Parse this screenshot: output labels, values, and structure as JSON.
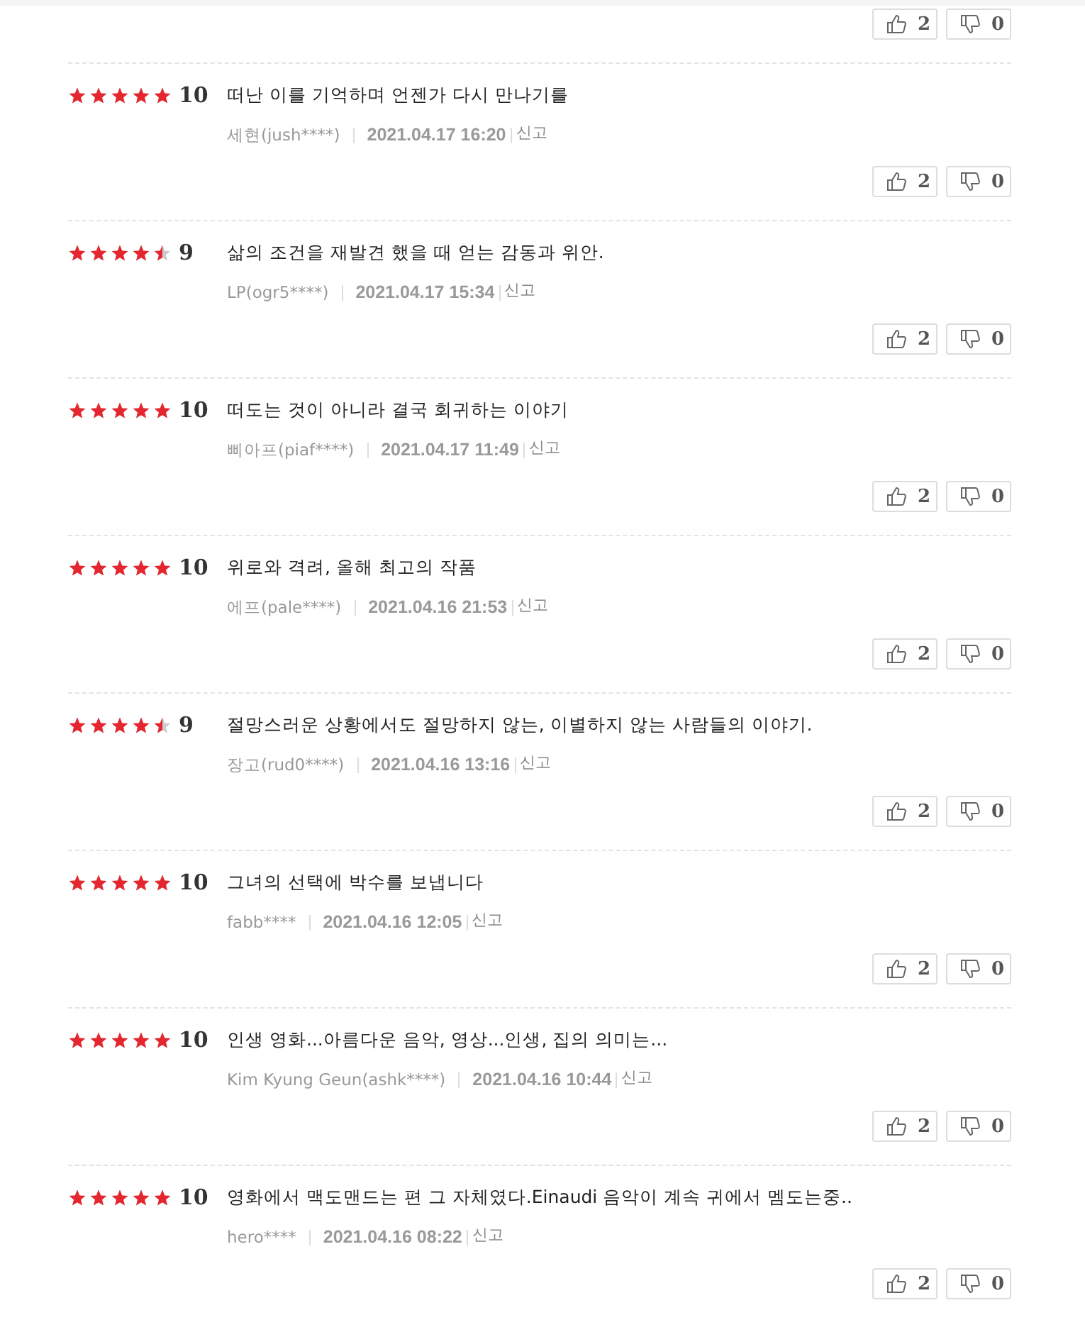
{
  "previous_review_votes": {
    "likes": "2",
    "dislikes": "0"
  },
  "reviews": [
    {
      "stars": 5,
      "score": "10",
      "text": "떠난 이를 기억하며 언젠가 다시 만나기를",
      "user": "세현(jush****)",
      "date": "2021.04.17 16:20",
      "report": "신고",
      "likes": "2",
      "dislikes": "0"
    },
    {
      "stars": 4.5,
      "score": "9",
      "text": "삶의 조건을 재발견 했을 때 얻는 감동과 위안.",
      "user": "LP(ogr5****)",
      "date": "2021.04.17 15:34",
      "report": "신고",
      "likes": "2",
      "dislikes": "0"
    },
    {
      "stars": 5,
      "score": "10",
      "text": "떠도는 것이 아니라 결국 회귀하는 이야기",
      "user": "삐아프(piaf****)",
      "date": "2021.04.17 11:49",
      "report": "신고",
      "likes": "2",
      "dislikes": "0"
    },
    {
      "stars": 5,
      "score": "10",
      "text": "위로와 격려, 올해 최고의 작품",
      "user": "에프(pale****)",
      "date": "2021.04.16 21:53",
      "report": "신고",
      "likes": "2",
      "dislikes": "0"
    },
    {
      "stars": 4.5,
      "score": "9",
      "text": "절망스러운 상황에서도 절망하지 않는, 이별하지 않는 사람들의 이야기.",
      "user": "장고(rud0****)",
      "date": "2021.04.16 13:16",
      "report": "신고",
      "likes": "2",
      "dislikes": "0"
    },
    {
      "stars": 5,
      "score": "10",
      "text": "그녀의 선택에 박수를 보냅니다",
      "user": "fabb****",
      "date": "2021.04.16 12:05",
      "report": "신고",
      "likes": "2",
      "dislikes": "0"
    },
    {
      "stars": 5,
      "score": "10",
      "text": "인생 영화...아름다운 음악, 영상...인생, 집의 의미는...",
      "user": "Kim Kyung Geun(ashk****)",
      "date": "2021.04.16 10:44",
      "report": "신고",
      "likes": "2",
      "dislikes": "0"
    },
    {
      "stars": 5,
      "score": "10",
      "text": "영화에서 맥도맨드는 편 그 자체였다.Einaudi 음악이 계속 귀에서 멤도는중..",
      "user": "hero****",
      "date": "2021.04.16 08:22",
      "report": "신고",
      "likes": "2",
      "dislikes": "0"
    }
  ]
}
